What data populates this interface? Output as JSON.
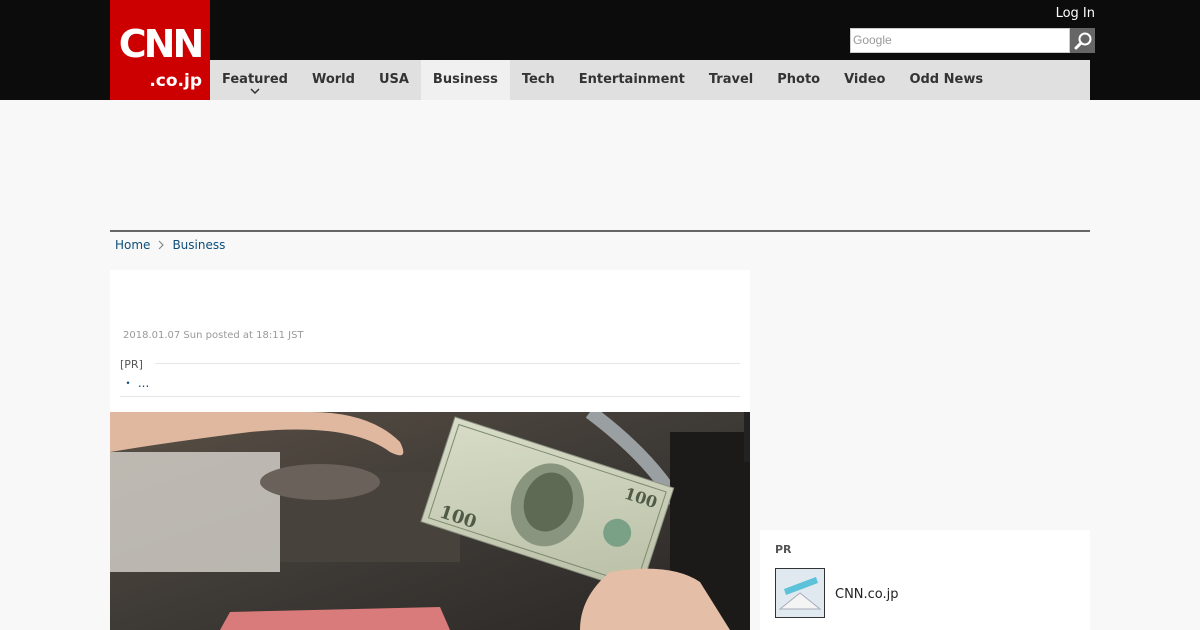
{
  "header": {
    "logo_brand": "CNN",
    "logo_tld": ".co.jp",
    "login": "Log In",
    "search_placeholder": "Google"
  },
  "nav": {
    "items": [
      {
        "label": "Featured"
      },
      {
        "label": "World"
      },
      {
        "label": "USA"
      },
      {
        "label": "Business"
      },
      {
        "label": "Tech"
      },
      {
        "label": "Entertainment"
      },
      {
        "label": "Travel"
      },
      {
        "label": "Photo"
      },
      {
        "label": "Video"
      },
      {
        "label": "Odd News"
      }
    ],
    "active": "Business"
  },
  "breadcrumb": {
    "home": "Home",
    "current": "Business"
  },
  "article": {
    "posted": "2018.01.07 Sun posted at 18:11 JST",
    "pr_label": "[PR]",
    "pr_item": "・ ..."
  },
  "sidebar": {
    "pr_title": "PR",
    "pr_item_name": "CNN.co.jp"
  },
  "colors": {
    "brand_red": "#cc0000",
    "top_bar": "#0c0c0c",
    "nav_bg": "#e0e0e0",
    "link": "#0d4d7a"
  }
}
